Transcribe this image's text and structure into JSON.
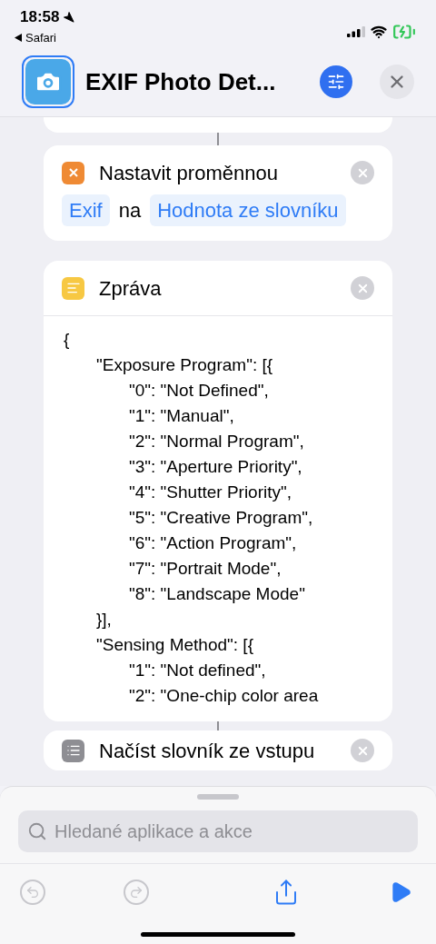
{
  "status_bar": {
    "time": "18:58",
    "back_app": "Safari"
  },
  "header": {
    "title": "EXIF Photo Det..."
  },
  "actions": [
    {
      "kind": "variable",
      "title": "Nastavit proměnnou",
      "tokens": [
        {
          "kind": "token",
          "text": "Exif"
        },
        {
          "kind": "plain",
          "text": "na"
        },
        {
          "kind": "token",
          "text": "Hodnota ze slovníku"
        }
      ]
    },
    {
      "kind": "text",
      "title": "Zpráva",
      "body": "{\n\t\"Exposure Program\": [{\n\t\t\"0\": \"Not Defined\",\n\t\t\"1\": \"Manual\",\n\t\t\"2\": \"Normal Program\",\n\t\t\"3\": \"Aperture Priority\",\n\t\t\"4\": \"Shutter Priority\",\n\t\t\"5\": \"Creative Program\",\n\t\t\"6\": \"Action Program\",\n\t\t\"7\": \"Portrait Mode\",\n\t\t\"8\": \"Landscape Mode\"\n\t}],\n\t\"Sensing Method\": [{\n\t\t\"1\": \"Not defined\",\n\t\t\"2\": \"One-chip color area"
    },
    {
      "kind": "dictionary",
      "title": "Načíst slovník ze vstupu"
    }
  ],
  "search": {
    "placeholder": "Hledané aplikace a akce"
  },
  "toolbar": [
    {
      "kind": "undo",
      "disabled": true
    },
    {
      "kind": "redo",
      "disabled": true
    },
    {
      "kind": "share",
      "disabled": false
    },
    {
      "kind": "run",
      "disabled": false
    }
  ]
}
